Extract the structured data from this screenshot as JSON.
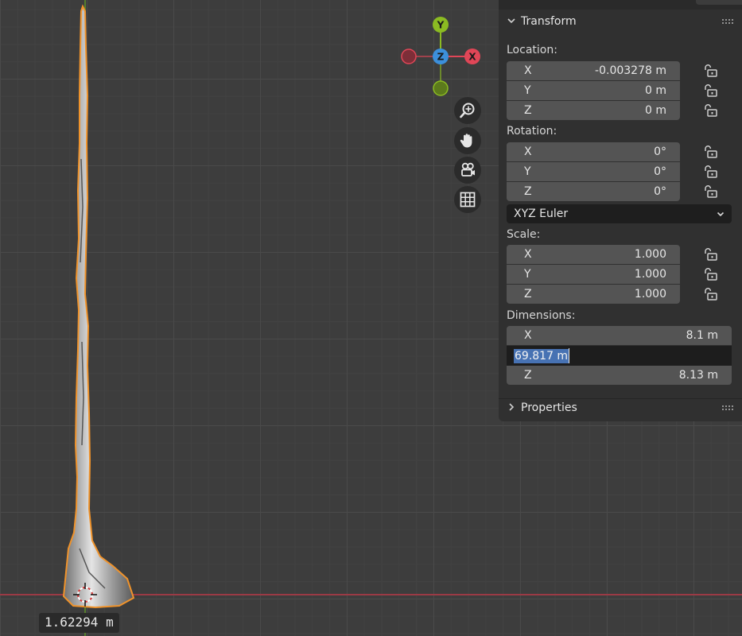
{
  "viewport": {
    "distance_readout": "1.62294 m",
    "gizmo": {
      "y_label": "Y",
      "z_label": "Z",
      "x_label": "X",
      "colors": {
        "x": "#e04657",
        "y": "#8bbb22",
        "z": "#3c8fdb"
      }
    },
    "nav_buttons": [
      "zoom-icon",
      "pan-hand-icon",
      "camera-icon",
      "grid-icon"
    ]
  },
  "panel": {
    "transform_header": "Transform",
    "location_label": "Location:",
    "location": [
      {
        "axis": "X",
        "value": "-0.003278 m"
      },
      {
        "axis": "Y",
        "value": "0 m"
      },
      {
        "axis": "Z",
        "value": "0 m"
      }
    ],
    "rotation_label": "Rotation:",
    "rotation": [
      {
        "axis": "X",
        "value": "0°"
      },
      {
        "axis": "Y",
        "value": "0°"
      },
      {
        "axis": "Z",
        "value": "0°"
      }
    ],
    "rotation_mode": "XYZ Euler",
    "scale_label": "Scale:",
    "scale": [
      {
        "axis": "X",
        "value": "1.000"
      },
      {
        "axis": "Y",
        "value": "1.000"
      },
      {
        "axis": "Z",
        "value": "1.000"
      }
    ],
    "dimensions_label": "Dimensions:",
    "dimensions": {
      "x": {
        "axis": "X",
        "value": "8.1 m"
      },
      "y_editing": "69.817 m",
      "z": {
        "axis": "Z",
        "value": "8.13 m"
      }
    },
    "properties_header": "Properties"
  }
}
